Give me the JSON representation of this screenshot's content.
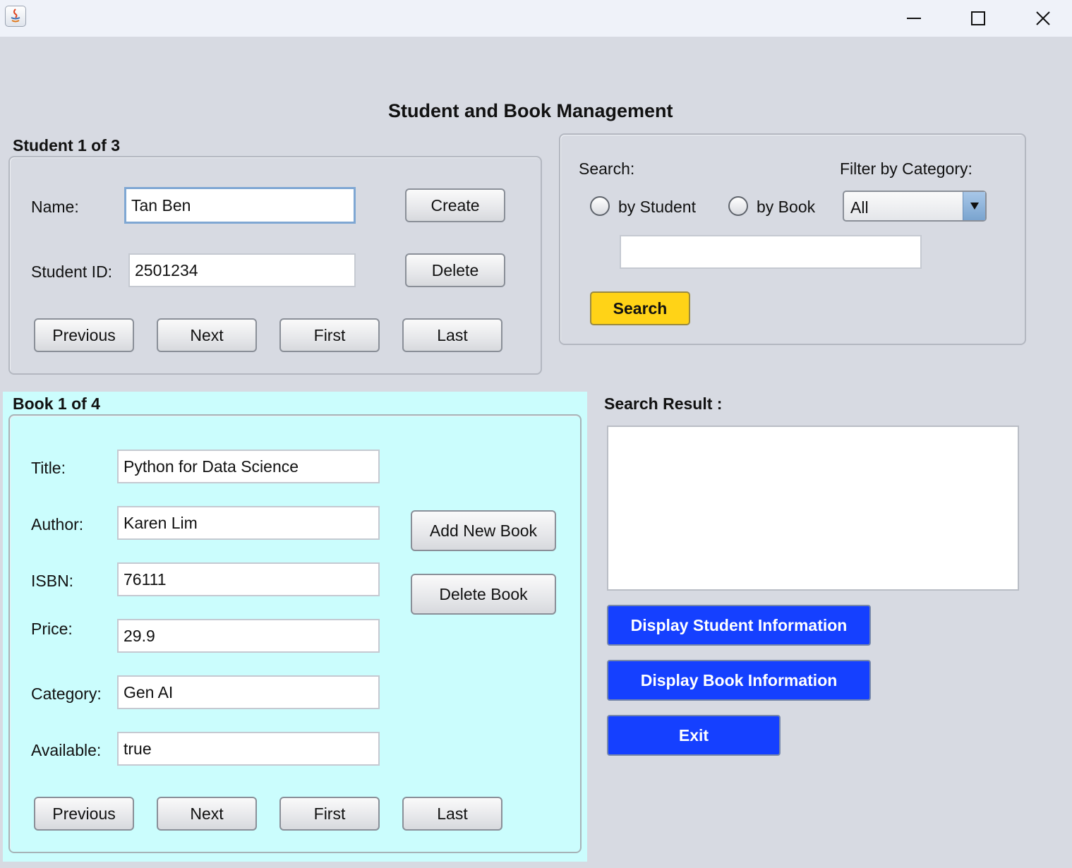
{
  "window": {
    "icon": "java-icon",
    "controls": [
      "minimize-icon",
      "maximize-icon",
      "close-icon"
    ]
  },
  "title": "Student and Book Management",
  "student": {
    "group_label": "Student 1 of 3",
    "name_label": "Name:",
    "name_value": "Tan Ben",
    "id_label": "Student ID:",
    "id_value": "2501234",
    "create": "Create",
    "delete": "Delete",
    "previous": "Previous",
    "next": "Next",
    "first": "First",
    "last": "Last"
  },
  "search": {
    "label": "Search:",
    "by_student": "by Student",
    "by_book": "by Book",
    "filter_label": "Filter by Category:",
    "filter_value": "All",
    "query": "",
    "button": "Search"
  },
  "book": {
    "group_label": "Book 1 of 4",
    "title_label": "Title:",
    "title_value": "Python for Data Science",
    "author_label": "Author:",
    "author_value": "Karen Lim",
    "isbn_label": "ISBN:",
    "isbn_value": "76111",
    "price_label": "Price:",
    "price_value": "29.9",
    "category_label": "Category:",
    "category_value": "Gen AI",
    "available_label": "Available:",
    "available_value": "true",
    "add": "Add New Book",
    "delete": "Delete Book",
    "previous": "Previous",
    "next": "Next",
    "first": "First",
    "last": "Last",
    "panel_color": "#cbfdfd"
  },
  "result": {
    "label": "Search Result :",
    "text": "",
    "display_student": "Display Student Information",
    "display_book": "Display Book Information",
    "exit": "Exit",
    "button_color": "#1540ff",
    "search_color": "#ffd317"
  }
}
